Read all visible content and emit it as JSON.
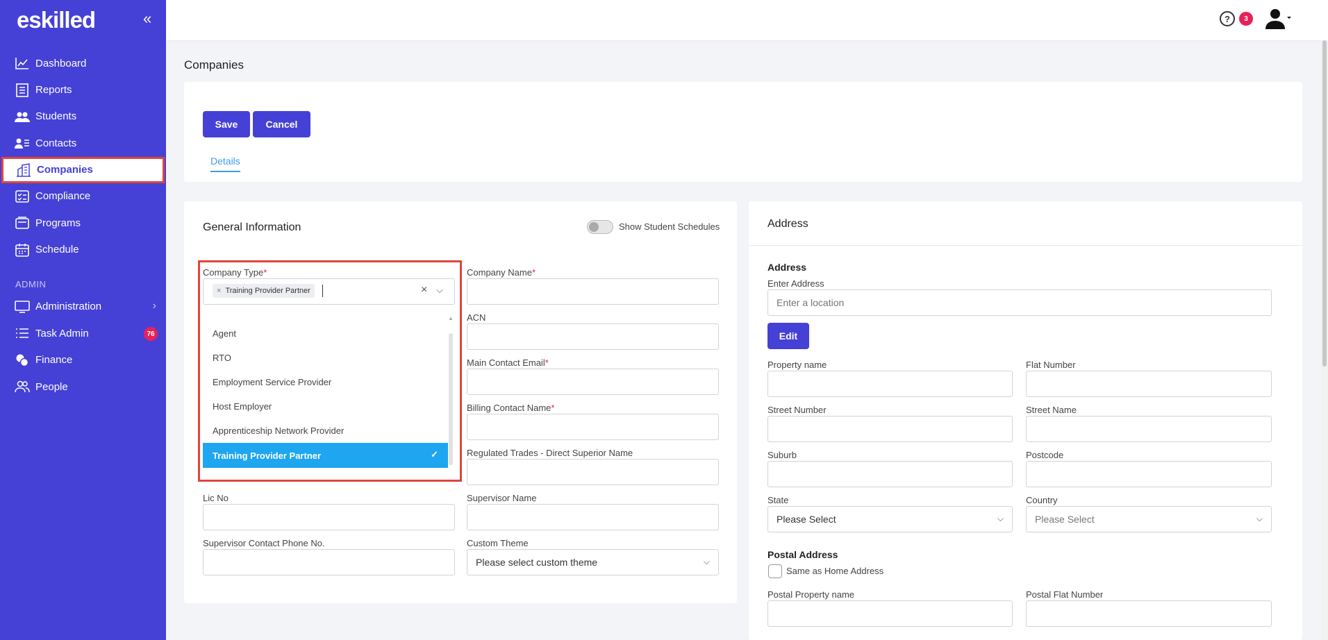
{
  "brand": {
    "logo": "eskilled"
  },
  "sidebar": {
    "items": [
      {
        "label": "Dashboard",
        "icon": "chart-line-icon"
      },
      {
        "label": "Reports",
        "icon": "report-icon"
      },
      {
        "label": "Students",
        "icon": "students-icon"
      },
      {
        "label": "Contacts",
        "icon": "contacts-icon"
      },
      {
        "label": "Companies",
        "icon": "building-icon"
      },
      {
        "label": "Compliance",
        "icon": "checklist-icon"
      },
      {
        "label": "Programs",
        "icon": "programs-icon"
      },
      {
        "label": "Schedule",
        "icon": "calendar-icon"
      }
    ],
    "admin_section": "ADMIN",
    "admin_items": [
      {
        "label": "Administration",
        "icon": "monitor-icon"
      },
      {
        "label": "Task Admin",
        "icon": "list-icon",
        "badge": "76"
      },
      {
        "label": "Finance",
        "icon": "coins-icon"
      },
      {
        "label": "People",
        "icon": "people-icon"
      }
    ]
  },
  "topbar": {
    "help_badge": "3"
  },
  "page": {
    "title": "Companies"
  },
  "toolbar": {
    "save_label": "Save",
    "cancel_label": "Cancel"
  },
  "tabs": [
    {
      "label": "Details"
    }
  ],
  "general": {
    "title": "General Information",
    "toggle_label": "Show Student Schedules",
    "company_type_label": "Company Type",
    "company_type_tag": "Training Provider Partner",
    "company_name_label": "Company Name",
    "acn_label": "ACN",
    "main_email_label": "Main Contact Email",
    "billing_name_label": "Billing Contact Name",
    "regulated_label": "Regulated Trades - Direct Superior Name",
    "lic_label": "Lic No",
    "supervisor_label": "Supervisor Name",
    "supervisor_phone_label": "Supervisor Contact Phone No.",
    "custom_theme_label": "Custom Theme",
    "custom_theme_value": "Please select custom theme",
    "dropdown_options": [
      "Agent",
      "RTO",
      "Employment Service Provider",
      "Host Employer",
      "Apprenticeship Network Provider"
    ],
    "dropdown_selected": "Training Provider Partner"
  },
  "address": {
    "card_title": "Address",
    "section_title": "Address",
    "enter_label": "Enter Address",
    "enter_placeholder": "Enter a location",
    "edit_label": "Edit",
    "property_label": "Property name",
    "flat_label": "Flat Number",
    "street_number_label": "Street Number",
    "street_name_label": "Street Name",
    "suburb_label": "Suburb",
    "postcode_label": "Postcode",
    "state_label": "State",
    "state_value": "Please Select",
    "country_label": "Country",
    "country_value": "Please Select",
    "postal_title": "Postal Address",
    "same_as_home": "Same as Home Address",
    "postal_property_label": "Postal Property name",
    "postal_flat_label": "Postal Flat Number"
  },
  "colors": {
    "sidebar": "#4541d6",
    "accent": "#4541d6",
    "highlight": "#e0453c",
    "selected": "#1ea6f0",
    "badge": "#e8205a"
  }
}
